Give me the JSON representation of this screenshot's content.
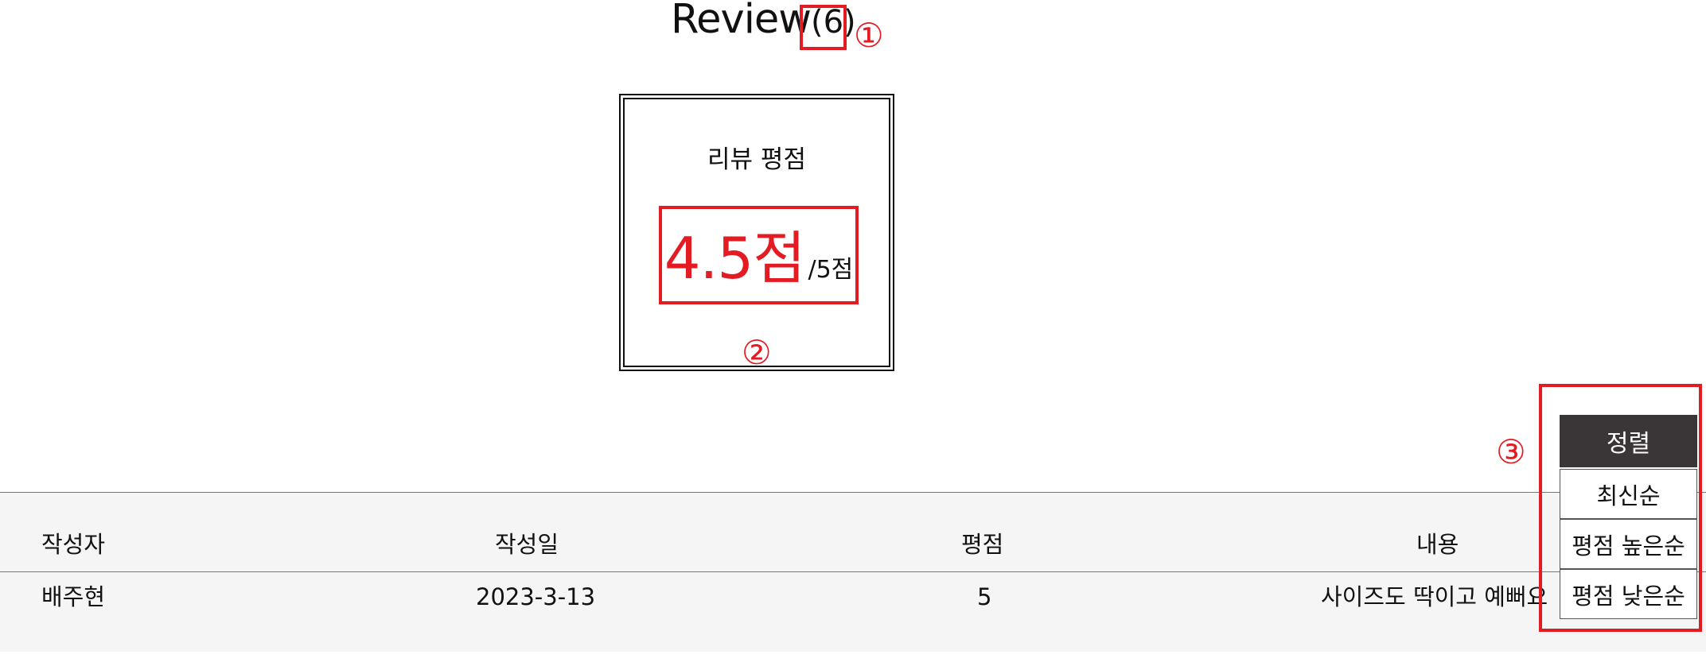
{
  "title": {
    "main": "Review",
    "count": "(6)"
  },
  "annotations": {
    "one": "①",
    "two": "②",
    "three": "③",
    "accent_color": "#e31b23"
  },
  "rating": {
    "label": "리뷰 평점",
    "value": "4.5점",
    "max": "/5점"
  },
  "sort": {
    "header": "정렬",
    "options": [
      "최신순",
      "평점 높은순",
      "평점 낮은순"
    ],
    "header_color": "#3a3637"
  },
  "table": {
    "columns": [
      "작성자",
      "작성일",
      "평점",
      "내용"
    ],
    "rows": [
      {
        "author": "배주현",
        "date": "2023-3-13",
        "score": "5",
        "content": "사이즈도 딱이고 예뻐요"
      }
    ]
  }
}
